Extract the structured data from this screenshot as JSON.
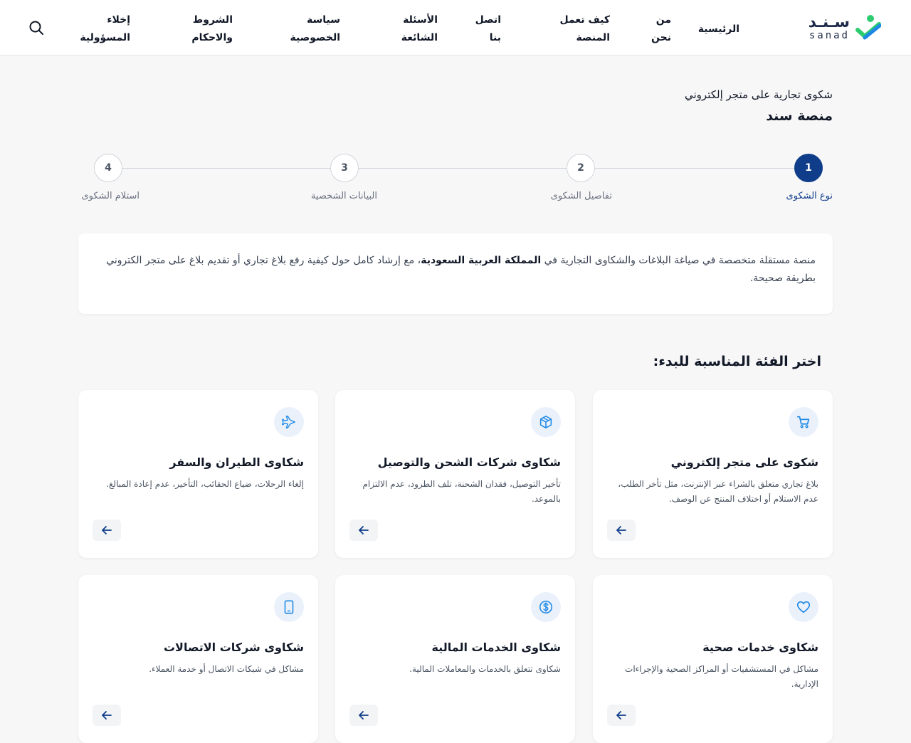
{
  "header": {
    "logo": {
      "ar": "سـنـد",
      "en": "sanad"
    },
    "nav": [
      {
        "id": "home",
        "label": "الرئيسية"
      },
      {
        "id": "about",
        "label": "من نحن"
      },
      {
        "id": "how",
        "label": "كيف تعمل المنصة"
      },
      {
        "id": "contact",
        "label": "اتصل بنا"
      },
      {
        "id": "faq",
        "label": "الأسئلة الشائعة"
      },
      {
        "id": "privacy",
        "label": "سياسة الخصوصية"
      },
      {
        "id": "terms",
        "label": "الشروط والاحكام"
      },
      {
        "id": "disclaimer",
        "label": "إخلاء المسؤولية"
      }
    ]
  },
  "page": {
    "subtitle": "شكوى تجارية على متجر إلكتروني",
    "title": "منصة سند"
  },
  "stepper": {
    "steps": [
      {
        "number": "1",
        "label": "نوع الشكوى"
      },
      {
        "number": "2",
        "label": "تفاصيل الشكوى"
      },
      {
        "number": "3",
        "label": "البيانات الشخصية"
      },
      {
        "number": "4",
        "label": "استلام الشكوى"
      }
    ]
  },
  "info": {
    "before": "منصة مستقلة متخصصة في صياغة البلاغات والشكاوى التجارية في ",
    "highlight": "المملكة العربية السعودية",
    "after": "، مع إرشاد كامل حول كيفية رفع بلاغ تجاري أو تقديم بلاغ على متجر الكتروني بطريقة صحيحة."
  },
  "categories_heading": "اختر الفئة المناسبة للبدء:",
  "categories": [
    {
      "title": "شكوى على متجر إلكتروني",
      "desc": "بلاغ تجاري متعلق بالشراء عبر الإنترنت، مثل تأخر الطلب، عدم الاستلام أو اختلاف المنتج عن الوصف.",
      "icon": "cart-icon"
    },
    {
      "title": "شكاوى شركات الشحن والتوصيل",
      "desc": "تأخير التوصيل، فقدان الشحنة، تلف الطرود، عدم الالتزام بالموعد.",
      "icon": "box-icon"
    },
    {
      "title": "شكاوى الطيران والسفر",
      "desc": "إلغاء الرحلات، ضياع الحقائب، التأخير، عدم إعادة المبالغ.",
      "icon": "plane-icon"
    },
    {
      "title": "شكاوى خدمات صحية",
      "desc": "مشاكل في المستشفيات أو المراكز الصحية والإجراءات الإدارية.",
      "icon": "heart-icon"
    },
    {
      "title": "شكاوى الخدمات المالية",
      "desc": "شكاوى تتعلق بالخدمات والمعاملات المالية.",
      "icon": "dollar-icon"
    },
    {
      "title": "شكاوى شركات الاتصالات",
      "desc": "مشاكل في شبكات الاتصال أو خدمة العملاء.",
      "icon": "phone-icon"
    }
  ],
  "colors": {
    "primary": "#0f3d8a",
    "accent": "#1e88e5",
    "icon_bg": "#eaf1fb",
    "logo_green": "#2ecc71",
    "logo_blue": "#1e88e5"
  }
}
